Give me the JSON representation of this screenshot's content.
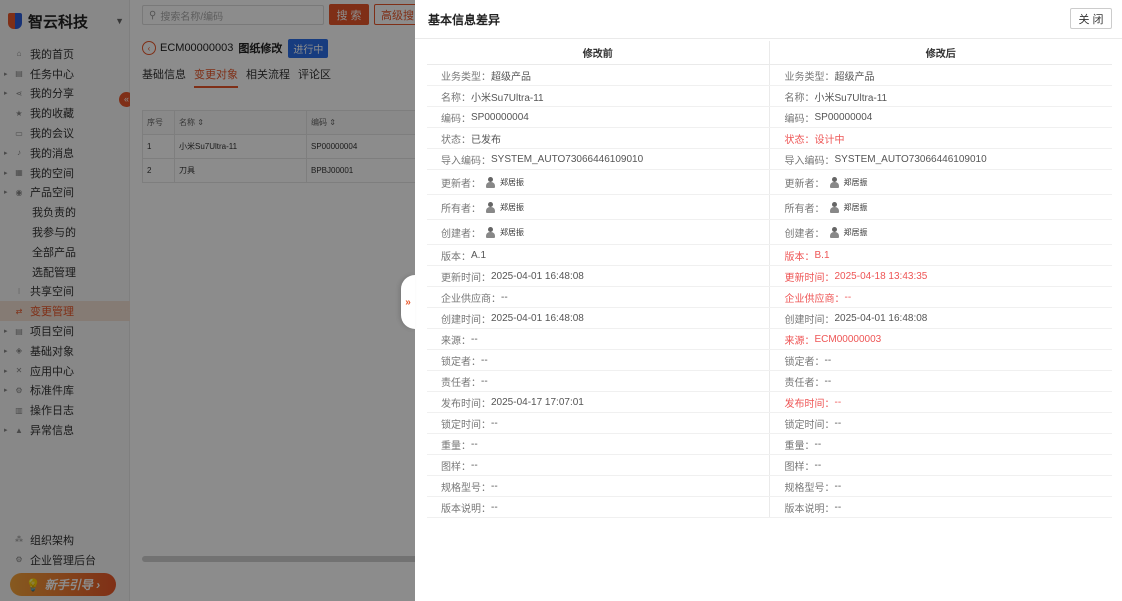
{
  "brand": {
    "name": "智云科技"
  },
  "sidebar": {
    "items": [
      {
        "label": "我的首页",
        "icon": "home-icon",
        "glyph": "⌂",
        "arrow": false,
        "sub": false,
        "active": false
      },
      {
        "label": "任务中心",
        "icon": "task-icon",
        "glyph": "▤",
        "arrow": true,
        "sub": false,
        "active": false
      },
      {
        "label": "我的分享",
        "icon": "share-icon",
        "glyph": "⋖",
        "arrow": true,
        "sub": false,
        "active": false
      },
      {
        "label": "我的收藏",
        "icon": "star-icon",
        "glyph": "★",
        "arrow": false,
        "sub": false,
        "active": false
      },
      {
        "label": "我的会议",
        "icon": "meeting-icon",
        "glyph": "▭",
        "arrow": false,
        "sub": false,
        "active": false
      },
      {
        "label": "我的消息",
        "icon": "bell-icon",
        "glyph": "♪",
        "arrow": true,
        "sub": false,
        "active": false
      },
      {
        "label": "我的空间",
        "icon": "space-icon",
        "glyph": "▦",
        "arrow": true,
        "sub": false,
        "active": false
      },
      {
        "label": "产品空间",
        "icon": "product-icon",
        "glyph": "◉",
        "arrow": true,
        "sub": false,
        "active": false
      },
      {
        "label": "我负责的",
        "icon": "",
        "glyph": "",
        "arrow": false,
        "sub": true,
        "active": false
      },
      {
        "label": "我参与的",
        "icon": "",
        "glyph": "",
        "arrow": false,
        "sub": true,
        "active": false
      },
      {
        "label": "全部产品",
        "icon": "",
        "glyph": "",
        "arrow": false,
        "sub": true,
        "active": false
      },
      {
        "label": "选配管理",
        "icon": "",
        "glyph": "",
        "arrow": false,
        "sub": true,
        "active": false
      },
      {
        "label": "共享空间",
        "icon": "shared-space-icon",
        "glyph": "⁝",
        "arrow": false,
        "sub": false,
        "active": false
      },
      {
        "label": "变更管理",
        "icon": "change-icon",
        "glyph": "⇄",
        "arrow": false,
        "sub": false,
        "active": true
      },
      {
        "label": "项目空间",
        "icon": "project-icon",
        "glyph": "▤",
        "arrow": true,
        "sub": false,
        "active": false
      },
      {
        "label": "基础对象",
        "icon": "object-icon",
        "glyph": "◈",
        "arrow": true,
        "sub": false,
        "active": false
      },
      {
        "label": "应用中心",
        "icon": "app-icon",
        "glyph": "✕",
        "arrow": true,
        "sub": false,
        "active": false
      },
      {
        "label": "标准件库",
        "icon": "library-icon",
        "glyph": "⚙",
        "arrow": true,
        "sub": false,
        "active": false
      },
      {
        "label": "操作日志",
        "icon": "log-icon",
        "glyph": "▥",
        "arrow": false,
        "sub": false,
        "active": false
      },
      {
        "label": "异常信息",
        "icon": "warning-icon",
        "glyph": "▲",
        "arrow": true,
        "sub": false,
        "active": false
      }
    ],
    "bottom": [
      {
        "label": "组织架构",
        "icon": "org-icon",
        "glyph": "⁂"
      },
      {
        "label": "企业管理后台",
        "icon": "settings-icon",
        "glyph": "⚙"
      }
    ],
    "guide_label": "新手引导 ›"
  },
  "main": {
    "search_placeholder": "搜索名称/编码",
    "search_button": "搜 索",
    "advanced_button": "高级搜",
    "ecm_code": "ECM00000003",
    "ecm_title": "图纸修改",
    "ecm_status": "进行中",
    "tabs": [
      "基础信息",
      "变更对象",
      "相关流程",
      "评论区"
    ],
    "table": {
      "headers": [
        "序号",
        "名称 ⇕",
        "编码 ⇕"
      ],
      "rows": [
        [
          "1",
          "小米Su7Ultra-11",
          "SP00000004"
        ],
        [
          "2",
          "刀具",
          "BPBJ00001"
        ]
      ]
    }
  },
  "drawer": {
    "title": "基本信息差异",
    "close_label": "关 闭",
    "col_before": "修改前",
    "col_after": "修改后",
    "rows": [
      {
        "before": {
          "label": "业务类型：",
          "value": "超级产品"
        },
        "after": {
          "label": "业务类型：",
          "value": "超级产品"
        },
        "diff": false,
        "user": false
      },
      {
        "before": {
          "label": "名称：",
          "value": "小米Su7Ultra-11"
        },
        "after": {
          "label": "名称：",
          "value": "小米Su7Ultra-11"
        },
        "diff": false,
        "user": false
      },
      {
        "before": {
          "label": "编码：",
          "value": "SP00000004"
        },
        "after": {
          "label": "编码：",
          "value": "SP00000004"
        },
        "diff": false,
        "user": false
      },
      {
        "before": {
          "label": "状态：",
          "value": "已发布"
        },
        "after": {
          "label": "状态：",
          "value": "设计中"
        },
        "diff": true,
        "user": false
      },
      {
        "before": {
          "label": "导入编码：",
          "value": "SYSTEM_AUTO73066446109010"
        },
        "after": {
          "label": "导入编码：",
          "value": "SYSTEM_AUTO73066446109010"
        },
        "diff": false,
        "user": false
      },
      {
        "before": {
          "label": "更新者：",
          "value": "郑居振"
        },
        "after": {
          "label": "更新者：",
          "value": "郑居振"
        },
        "diff": false,
        "user": true
      },
      {
        "before": {
          "label": "所有者：",
          "value": "郑居振"
        },
        "after": {
          "label": "所有者：",
          "value": "郑居振"
        },
        "diff": false,
        "user": true
      },
      {
        "before": {
          "label": "创建者：",
          "value": "郑居振"
        },
        "after": {
          "label": "创建者：",
          "value": "郑居振"
        },
        "diff": false,
        "user": true
      },
      {
        "before": {
          "label": "版本：",
          "value": "A.1"
        },
        "after": {
          "label": "版本：",
          "value": "B.1"
        },
        "diff": true,
        "user": false
      },
      {
        "before": {
          "label": "更新时间：",
          "value": "2025-04-01 16:48:08"
        },
        "after": {
          "label": "更新时间：",
          "value": "2025-04-18 13:43:35"
        },
        "diff": true,
        "user": false
      },
      {
        "before": {
          "label": "企业供应商：",
          "value": "--"
        },
        "after": {
          "label": "企业供应商：",
          "value": "--"
        },
        "diff": true,
        "user": false
      },
      {
        "before": {
          "label": "创建时间：",
          "value": "2025-04-01 16:48:08"
        },
        "after": {
          "label": "创建时间：",
          "value": "2025-04-01 16:48:08"
        },
        "diff": false,
        "user": false
      },
      {
        "before": {
          "label": "来源：",
          "value": "--"
        },
        "after": {
          "label": "来源：",
          "value": "ECM00000003"
        },
        "diff": true,
        "user": false
      },
      {
        "before": {
          "label": "锁定者：",
          "value": "--"
        },
        "after": {
          "label": "锁定者：",
          "value": "--"
        },
        "diff": false,
        "user": false
      },
      {
        "before": {
          "label": "责任者：",
          "value": "--"
        },
        "after": {
          "label": "责任者：",
          "value": "--"
        },
        "diff": false,
        "user": false
      },
      {
        "before": {
          "label": "发布时间：",
          "value": "2025-04-17 17:07:01"
        },
        "after": {
          "label": "发布时间：",
          "value": "--"
        },
        "diff": true,
        "user": false
      },
      {
        "before": {
          "label": "锁定时间：",
          "value": "--"
        },
        "after": {
          "label": "锁定时间：",
          "value": "--"
        },
        "diff": false,
        "user": false
      },
      {
        "before": {
          "label": "重量：",
          "value": "--"
        },
        "after": {
          "label": "重量：",
          "value": "--"
        },
        "diff": false,
        "user": false
      },
      {
        "before": {
          "label": "图样：",
          "value": "--"
        },
        "after": {
          "label": "图样：",
          "value": "--"
        },
        "diff": false,
        "user": false
      },
      {
        "before": {
          "label": "规格型号：",
          "value": "--"
        },
        "after": {
          "label": "规格型号：",
          "value": "--"
        },
        "diff": false,
        "user": false
      },
      {
        "before": {
          "label": "版本说明：",
          "value": "--"
        },
        "after": {
          "label": "版本说明：",
          "value": "--"
        },
        "diff": false,
        "user": false
      }
    ]
  },
  "colors": {
    "accent": "#e8572a",
    "diff": "#ee5555",
    "badge": "#2a6ee8"
  }
}
